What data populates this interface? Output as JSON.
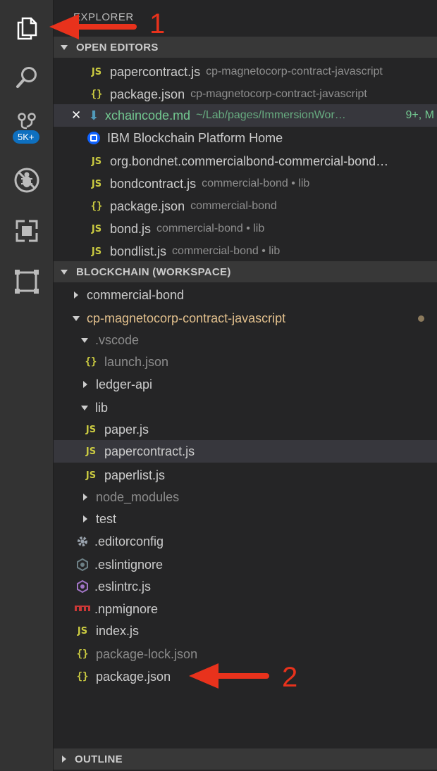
{
  "activity_bar": {
    "items": [
      {
        "name": "explorer",
        "icon": "files-icon"
      },
      {
        "name": "search",
        "icon": "search-icon"
      },
      {
        "name": "source-control",
        "icon": "source-control-icon",
        "badge": "5K+"
      },
      {
        "name": "debug",
        "icon": "debug-icon"
      },
      {
        "name": "extensions",
        "icon": "extensions-icon"
      },
      {
        "name": "blockchain",
        "icon": "blockchain-icon"
      }
    ],
    "badge_color": "#0e70c0"
  },
  "sidebar": {
    "title": "EXPLORER",
    "open_editors": {
      "header": "OPEN EDITORS",
      "items": [
        {
          "icon": "JS",
          "name": "papercontract.js",
          "desc": "cp-magnetocorp-contract-javascript"
        },
        {
          "icon": "{}",
          "name": "package.json",
          "desc": "cp-magnetocorp-contract-javascript"
        },
        {
          "icon": "md",
          "name": "xchaincode.md",
          "desc": "~/Lab/pages/ImmersionWor…",
          "badge": "9+, M"
        },
        {
          "icon": "ibm",
          "name": "IBM Blockchain Platform Home",
          "desc": ""
        },
        {
          "icon": "JS",
          "name": "org.bondnet.commercialbond-commercial-bond…",
          "desc": ""
        },
        {
          "icon": "JS",
          "name": "bondcontract.js",
          "desc": "commercial-bond • lib"
        },
        {
          "icon": "{}",
          "name": "package.json",
          "desc": "commercial-bond"
        },
        {
          "icon": "JS",
          "name": "bond.js",
          "desc": "commercial-bond • lib"
        },
        {
          "icon": "JS",
          "name": "bondlist.js",
          "desc": "commercial-bond • lib"
        }
      ]
    },
    "workspace": {
      "header": "BLOCKCHAIN (WORKSPACE)",
      "tree": [
        {
          "label": "commercial-bond"
        },
        {
          "label": "cp-magnetocorp-contract-javascript"
        },
        {
          "label": ".vscode"
        },
        {
          "label": "launch.json",
          "icon": "{}"
        },
        {
          "label": "ledger-api"
        },
        {
          "label": "lib"
        },
        {
          "label": "paper.js",
          "icon": "JS"
        },
        {
          "label": "papercontract.js",
          "icon": "JS"
        },
        {
          "label": "paperlist.js",
          "icon": "JS"
        },
        {
          "label": "node_modules"
        },
        {
          "label": "test"
        },
        {
          "label": ".editorconfig"
        },
        {
          "label": ".eslintignore"
        },
        {
          "label": ".eslintrc.js"
        },
        {
          "label": ".npmignore"
        },
        {
          "label": "index.js",
          "icon": "JS"
        },
        {
          "label": "package-lock.json",
          "icon": "{}"
        },
        {
          "label": "package.json",
          "icon": "{}"
        }
      ]
    },
    "outline": {
      "header": "OUTLINE"
    }
  },
  "annotations": {
    "label_1": "1",
    "label_2": "2",
    "color": "#e8321c"
  }
}
